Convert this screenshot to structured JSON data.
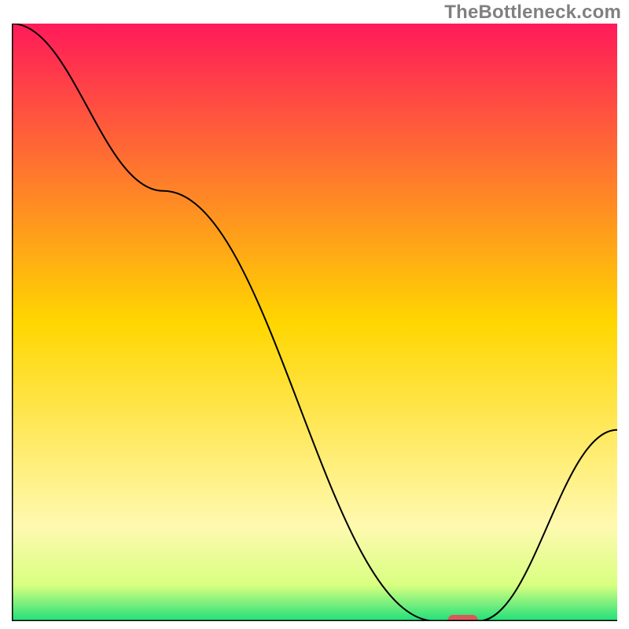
{
  "watermark": "TheBottleneck.com",
  "chart_data": {
    "type": "line",
    "title": "",
    "xlabel": "",
    "ylabel": "",
    "xlim": [
      0,
      100
    ],
    "ylim": [
      0,
      100
    ],
    "x": [
      0,
      25,
      70,
      73,
      77,
      100
    ],
    "values": [
      100,
      72,
      0,
      0,
      0,
      32
    ],
    "marker": {
      "x_start": 72,
      "x_end": 77,
      "y": 0
    },
    "background_gradient_stops": [
      {
        "pct": 0,
        "color": "#ff1a5a"
      },
      {
        "pct": 50,
        "color": "#ffd600"
      },
      {
        "pct": 84,
        "color": "#fff9b0"
      },
      {
        "pct": 94,
        "color": "#d8ff80"
      },
      {
        "pct": 100,
        "color": "#1ee07a"
      }
    ],
    "axis_color": "#000000",
    "line_color": "#000000",
    "marker_color": "#d75a5a"
  }
}
